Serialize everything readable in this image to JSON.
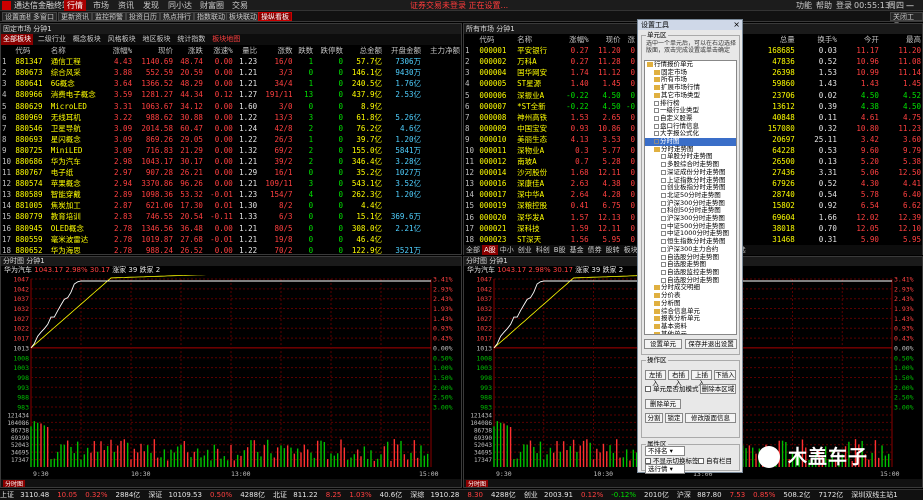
{
  "window": {
    "app_title": "通达信金融终端",
    "menus": [
      "行情",
      "市场",
      "资讯",
      "发现",
      "同小达",
      "财富圈",
      "交易"
    ],
    "active_menu": "行情",
    "notice": "证券交易未登录  正在设置...",
    "sys_items": [
      "功能",
      "帮助",
      "登录",
      "00:55:13",
      "周四"
    ]
  },
  "toolbar": {
    "buttons": [
      "设置面板",
      "多窗口",
      "更新资讯",
      "监控预警",
      "投资日历",
      "热点排行",
      "指数联动",
      "板块联动",
      "操纵看板"
    ],
    "active_button": "操纵看板",
    "right_text": "关闭工具"
  },
  "left_panel": {
    "title": "固定市场 分钟1",
    "tabs": [
      "全部板块",
      "二级行业",
      "概念板块",
      "风格板块",
      "地区板块",
      "统计指数",
      "板块地图"
    ],
    "active_tab": "全部板块",
    "columns": [
      "",
      "代码",
      "名称",
      "涨幅%",
      "现价",
      "涨跌",
      "涨速%",
      "量比",
      "涨数",
      "跌数",
      "跌停数",
      "总金额",
      "开盘金额",
      "主力净额"
    ],
    "rows": [
      [
        "1",
        "881347",
        "通信工程",
        "4.43",
        "1140.69",
        "48.74",
        "0.00",
        "1.23",
        "16/0",
        "1",
        "0",
        "57.7亿",
        "7306万",
        ""
      ],
      [
        "2",
        "880673",
        "综合风采",
        "3.88",
        "552.59",
        "20.59",
        "0.00",
        "1.21",
        "3/3",
        "0",
        "0",
        "146.1亿",
        "9430万",
        ""
      ],
      [
        "3",
        "880641",
        "6G概念",
        "3.64",
        "1366.52",
        "48.29",
        "0.00",
        "1.21",
        "34/4",
        "1",
        "0",
        "240.5亿",
        "1.76亿",
        ""
      ],
      [
        "4",
        "880966",
        "消费电子概念",
        "3.59",
        "1281.27",
        "44.34",
        "0.12",
        "1.27",
        "191/11",
        "13",
        "0",
        "437.9亿",
        "2.53亿",
        ""
      ],
      [
        "5",
        "880629",
        "MicroLED",
        "3.31",
        "1063.67",
        "34.12",
        "0.00",
        "1.60",
        "3/0",
        "0",
        "0",
        "8.9亿",
        "",
        ""
      ],
      [
        "6",
        "880969",
        "无线耳机",
        "3.22",
        "988.62",
        "30.88",
        "0.00",
        "1.22",
        "13/3",
        "3",
        "0",
        "61.8亿",
        "5.26亿",
        ""
      ],
      [
        "7",
        "880546",
        "卫星导航",
        "3.09",
        "2014.58",
        "60.47",
        "0.00",
        "1.24",
        "42/8",
        "2",
        "0",
        "76.2亿",
        "4.6亿",
        ""
      ],
      [
        "8",
        "880693",
        "星闪概念",
        "3.09",
        "869.26",
        "29.05",
        "0.00",
        "1.22",
        "26/3",
        "1",
        "0",
        "39.7亿",
        "1.20亿",
        ""
      ],
      [
        "9",
        "880725",
        "MiniLED",
        "3.09",
        "716.83",
        "21.29",
        "0.00",
        "1.32",
        "69/2",
        "2",
        "0",
        "155.0亿",
        "5841万",
        ""
      ],
      [
        "10",
        "880686",
        "华为汽车",
        "2.98",
        "1043.17",
        "30.17",
        "0.00",
        "1.21",
        "39/2",
        "2",
        "0",
        "346.4亿",
        "3.28亿",
        ""
      ],
      [
        "11",
        "880767",
        "电子纸",
        "2.97",
        "907.28",
        "26.21",
        "0.00",
        "1.29",
        "16/1",
        "0",
        "0",
        "35.2亿",
        "1027万",
        ""
      ],
      [
        "12",
        "880574",
        "苹果概念",
        "2.94",
        "3370.86",
        "96.26",
        "0.00",
        "1.21",
        "109/11",
        "3",
        "0",
        "543.1亿",
        "3.52亿",
        ""
      ],
      [
        "13",
        "880589",
        "智能穿戴",
        "2.89",
        "1098.36",
        "53.32",
        "-0.01",
        "1.23",
        "154/7",
        "4",
        "0",
        "262.3亿",
        "1.20亿",
        ""
      ],
      [
        "14",
        "881005",
        "焦炭加工",
        "2.87",
        "621.06",
        "17.30",
        "0.01",
        "1.30",
        "8/2",
        "0",
        "0",
        "4.4亿",
        "",
        ""
      ],
      [
        "15",
        "880779",
        "教育培训",
        "2.83",
        "746.55",
        "20.54",
        "-0.11",
        "1.33",
        "6/3",
        "0",
        "0",
        "15.1亿",
        "369.6万",
        ""
      ],
      [
        "16",
        "880945",
        "OLED概念",
        "2.78",
        "1346.56",
        "36.48",
        "0.00",
        "1.21",
        "80/5",
        "0",
        "0",
        "308.0亿",
        "2.21亿",
        ""
      ],
      [
        "17",
        "880559",
        "毫米波雷达",
        "2.78",
        "1019.87",
        "27.68",
        "-0.01",
        "1.21",
        "19/8",
        "0",
        "0",
        "46.4亿",
        "",
        ""
      ],
      [
        "18",
        "880652",
        "华为海思",
        "2.78",
        "988.24",
        "26.52",
        "0.00",
        "1.22",
        "70/2",
        "0",
        "0",
        "122.9亿",
        "3521万",
        ""
      ],
      [
        "19",
        "880511",
        "橡胶",
        "2.77",
        "681.06",
        "18.30",
        "0.00",
        "1.23",
        "11/1",
        "1",
        "0",
        "13.3亿",
        "384.5万",
        ""
      ]
    ]
  },
  "right_panel": {
    "title": "所有市场 分钟1",
    "tabs": [
      "全部",
      "A股",
      "中小",
      "创业",
      "科创",
      "B股",
      "基金",
      "债券",
      "股转",
      "板块",
      "港股",
      "期权",
      "美股",
      "期货",
      "外汇",
      "自选"
    ],
    "active_tab": "A股",
    "columns_left": [
      "",
      "代码",
      "名称",
      "涨幅%",
      "现价",
      "涨"
    ],
    "columns_right": [
      "总量",
      "换手%",
      "今开",
      "最高"
    ],
    "rows_left": [
      [
        "1",
        "000001",
        "平安银行",
        "0.27",
        "11.20",
        "0"
      ],
      [
        "2",
        "000002",
        "万科A",
        "0.27",
        "11.28",
        "0"
      ],
      [
        "3",
        "000004",
        "国华网安",
        "1.74",
        "11.12",
        "0"
      ],
      [
        "4",
        "000005",
        "ST星源",
        "1.40",
        "1.45",
        "0"
      ],
      [
        "5",
        "000006",
        "深振业A",
        "-0.22",
        "4.50",
        "0"
      ],
      [
        "6",
        "000007",
        "*ST全新",
        "-0.22",
        "4.50",
        "-0"
      ],
      [
        "7",
        "000008",
        "神州高铁",
        "1.53",
        "2.65",
        "0"
      ],
      [
        "8",
        "000009",
        "中国宝安",
        "0.93",
        "10.86",
        "0"
      ],
      [
        "9",
        "000010",
        "美丽生态",
        "4.13",
        "3.53",
        "0"
      ],
      [
        "10",
        "000011",
        "深物业A",
        "0.3",
        "5.77",
        "0"
      ],
      [
        "11",
        "000012",
        "南玻A",
        "0.7",
        "5.28",
        "0"
      ],
      [
        "12",
        "000014",
        "沙河股份",
        "1.68",
        "12.11",
        "0"
      ],
      [
        "13",
        "000016",
        "深康佳A",
        "2.63",
        "4.38",
        "0"
      ],
      [
        "14",
        "000017",
        "深中华A",
        "2.64",
        "4.28",
        "0"
      ],
      [
        "15",
        "000019",
        "深粮控股",
        "0.41",
        "6.75",
        "0"
      ],
      [
        "16",
        "000020",
        "深华发A",
        "1.57",
        "12.13",
        "0"
      ],
      [
        "17",
        "000021",
        "深科技",
        "1.59",
        "12.11",
        "0"
      ],
      [
        "18",
        "000023",
        "ST深天",
        "1.56",
        "5.95",
        "0"
      ],
      [
        "19",
        "000025",
        "特力A",
        "1.56",
        "12.65",
        "0"
      ]
    ],
    "rows_right": [
      [
        "168685",
        "0.03",
        "11.17",
        "11.20"
      ],
      [
        "47836",
        "0.52",
        "10.96",
        "11.08"
      ],
      [
        "26398",
        "1.53",
        "10.99",
        "11.14"
      ],
      [
        "59860",
        "1.43",
        "1.43",
        "1.45"
      ],
      [
        "23706",
        "0.02",
        "4.50",
        "4.52"
      ],
      [
        "13612",
        "0.39",
        "4.38",
        "4.50"
      ],
      [
        "40848",
        "0.11",
        "4.61",
        "4.75"
      ],
      [
        "157080",
        "0.32",
        "10.80",
        "11.23"
      ],
      [
        "20697",
        "25.11",
        "3.42",
        "3.60"
      ],
      [
        "64228",
        "0.53",
        "9.60",
        "9.79"
      ],
      [
        "26500",
        "0.13",
        "5.20",
        "5.38"
      ],
      [
        "27436",
        "3.31",
        "5.06",
        "12.50"
      ],
      [
        "67926",
        "0.52",
        "4.30",
        "4.41"
      ],
      [
        "28740",
        "0.54",
        "5.78",
        "6.40"
      ],
      [
        "15802",
        "0.92",
        "6.54",
        "6.62"
      ],
      [
        "69604",
        "1.66",
        "12.02",
        "12.39"
      ],
      [
        "38018",
        "0.70",
        "12.05",
        "12.10"
      ],
      [
        "31468",
        "0.31",
        "5.90",
        "5.95"
      ],
      [
        "4486",
        "0.04",
        "12.60",
        "12.68"
      ]
    ]
  },
  "chart_left": {
    "header": "分时图 分钟1",
    "legend_name": "华为汽车",
    "legend_value": "1043.17",
    "legend_pct": "2.98%",
    "legend_up": "30.17",
    "legend_rise": "涨家 39",
    "legend_fall": "跌家 2",
    "y_labels": [
      "1047",
      "1042",
      "1037",
      "1032",
      "1027",
      "1022",
      "1017",
      "1013",
      "1008",
      "1003",
      "998",
      "993",
      "988",
      "983"
    ],
    "y_labels_right": [
      "3.41%",
      "2.93%",
      "2.43%",
      "1.93%",
      "1.43%",
      "0.93%",
      "0.43%",
      "0.00%",
      "0.50%",
      "1.00%",
      "1.50%",
      "2.00%",
      "2.50%",
      "3.00%"
    ],
    "vol_labels": [
      "121434",
      "104086",
      "86738",
      "69390",
      "52043",
      "34695",
      "17347"
    ],
    "x_labels": [
      "9:30",
      "10:30",
      "13:00",
      "15:00"
    ]
  },
  "chart_right": {
    "header": "分时图 分钟1",
    "legend_name": "华为汽车",
    "legend_value": "1043.17",
    "legend_pct": "2.98%",
    "legend_up": "30.17",
    "legend_rise": "涨家 39",
    "legend_fall": "跌家 2",
    "y_labels": [
      "1047",
      "1042",
      "1037",
      "1032",
      "1027",
      "1022",
      "1017",
      "1013",
      "1008",
      "1003",
      "998",
      "993",
      "988",
      "983"
    ],
    "y_labels_right": [
      "3.41%",
      "2.93%",
      "2.43%",
      "1.93%",
      "1.43%",
      "0.93%",
      "0.43%",
      "0.00%",
      "0.50%",
      "1.00%",
      "1.50%",
      "2.00%",
      "2.50%",
      "3.00%"
    ],
    "vol_labels": [
      "121434",
      "104086",
      "86738",
      "69390",
      "52043",
      "34695",
      "17347"
    ],
    "x_labels": [
      "9:30",
      "10:30",
      "13:00",
      "15:00"
    ]
  },
  "dialog": {
    "title": "设置工具",
    "close": "×",
    "unit_group": "单元区",
    "unit_help": "选中一个单元后，可以在右边选择版面，双击完成设置或单击确定",
    "tree": [
      {
        "label": "行情报价单元",
        "level": 0,
        "folder": true
      },
      {
        "label": "固定市场",
        "level": 1,
        "folder": true
      },
      {
        "label": "所有市场",
        "level": 1,
        "folder": true
      },
      {
        "label": "扩展市场行情",
        "level": 1,
        "folder": true
      },
      {
        "label": "其它市场类型",
        "level": 1,
        "folder": true
      },
      {
        "label": "排行榜",
        "level": 1,
        "folder": false
      },
      {
        "label": "一级行业类型",
        "level": 1,
        "folder": false
      },
      {
        "label": "自定义股票",
        "level": 1,
        "folder": false
      },
      {
        "label": "盘口行情信息",
        "level": 1,
        "folder": false
      },
      {
        "label": "大字报公式化",
        "level": 1,
        "folder": false
      },
      {
        "label": "分时图",
        "level": 1,
        "folder": false,
        "selected": true
      },
      {
        "label": "分时走势图",
        "level": 1,
        "folder": true
      },
      {
        "label": "单股分时走势图",
        "level": 2,
        "folder": false
      },
      {
        "label": "多股综合时走势图",
        "level": 2,
        "folder": false
      },
      {
        "label": "深证成份分时走势图",
        "level": 2,
        "folder": false
      },
      {
        "label": "上证指数分时走势图",
        "level": 2,
        "folder": false
      },
      {
        "label": "创业板指分时走势图",
        "level": 2,
        "folder": false
      },
      {
        "label": "北证50分时走势图",
        "level": 2,
        "folder": false
      },
      {
        "label": "沪深300分时走势图",
        "level": 2,
        "folder": false
      },
      {
        "label": "科创50分时走势图",
        "level": 2,
        "folder": false
      },
      {
        "label": "沪深300分时走势图",
        "level": 2,
        "folder": false
      },
      {
        "label": "中证500分时走势图",
        "level": 2,
        "folder": false
      },
      {
        "label": "中证1000分时走势图",
        "level": 2,
        "folder": false
      },
      {
        "label": "恒生指数分时走势图",
        "level": 2,
        "folder": false
      },
      {
        "label": "沪深300主力合约",
        "level": 2,
        "folder": false
      },
      {
        "label": "自选股分时走势图",
        "level": 2,
        "folder": false
      },
      {
        "label": "自选股走势图",
        "level": 2,
        "folder": false
      },
      {
        "label": "自选股监控走势图",
        "level": 2,
        "folder": false
      },
      {
        "label": "自选股分时走势图",
        "level": 2,
        "folder": false
      },
      {
        "label": "分时成交明细",
        "level": 1,
        "folder": true
      },
      {
        "label": "分价表",
        "level": 1,
        "folder": true
      },
      {
        "label": "分析图",
        "level": 1,
        "folder": true
      },
      {
        "label": "综合信息单元",
        "level": 1,
        "folder": true
      },
      {
        "label": "报表分析单元",
        "level": 1,
        "folder": true
      },
      {
        "label": "基本资料",
        "level": 1,
        "folder": true
      },
      {
        "label": "其他单元",
        "level": 1,
        "folder": true
      }
    ],
    "btn_set_unit": "设置单元",
    "btn_save_exit": "保存并退出设置",
    "op_group": "操作区",
    "btn_left": "左插入",
    "btn_right": "右插入",
    "btn_up": "上插入",
    "btn_down": "下插入",
    "chk_unit_mode": "单元是否加模式",
    "btn_delete_unit": "删除单元",
    "btn_delete_region": "删除本区域",
    "btn_split": "分割",
    "btn_lock": "锁定",
    "btn_modify": "修改版面信息",
    "attr_group": "属性区",
    "attr_select": "不排名",
    "chk_no_switch": "不显示切换标签",
    "chk_auto_color": "自有栏目",
    "select_row": "选行情"
  },
  "status": {
    "items": [
      {
        "label": "上证",
        "value": "3110.48",
        "cls": "wh"
      },
      {
        "label": "",
        "value": "10.05",
        "cls": "up"
      },
      {
        "label": "",
        "value": "0.32%",
        "cls": "up"
      },
      {
        "label": "",
        "value": "2884亿",
        "cls": "wh"
      },
      {
        "label": "深证",
        "value": "10109.53",
        "cls": "wh"
      },
      {
        "label": "",
        "value": "0.50%",
        "cls": "up"
      },
      {
        "label": "",
        "value": "4288亿",
        "cls": "wh"
      },
      {
        "label": "北证",
        "value": "811.22",
        "cls": "wh"
      },
      {
        "label": "",
        "value": "8.25",
        "cls": "up"
      },
      {
        "label": "",
        "value": "1.03%",
        "cls": "up"
      },
      {
        "label": "",
        "value": "40.6亿",
        "cls": "wh"
      },
      {
        "label": "深综",
        "value": "1910.28",
        "cls": "wh"
      },
      {
        "label": "",
        "value": "8.30",
        "cls": "up"
      },
      {
        "label": "",
        "value": "4288亿",
        "cls": "wh"
      },
      {
        "label": "创业",
        "value": "2003.91",
        "cls": "wh"
      },
      {
        "label": "",
        "value": "0.12%",
        "cls": "up"
      },
      {
        "label": "",
        "value": "-0.12%",
        "cls": "dn"
      },
      {
        "label": "",
        "value": "2010亿",
        "cls": "wh"
      },
      {
        "label": "沪深",
        "value": "887.80",
        "cls": "wh"
      },
      {
        "label": "",
        "value": "7.53",
        "cls": "up"
      },
      {
        "label": "",
        "value": "0.85%",
        "cls": "up"
      },
      {
        "label": "",
        "value": "508.2亿",
        "cls": "wh"
      },
      {
        "label": "",
        "value": "7172亿",
        "cls": "wh"
      },
      {
        "label": "",
        "value": "深圳双线主站1",
        "cls": "wh"
      }
    ]
  },
  "watermark": {
    "text": "木盖车子"
  },
  "colors": {
    "up": "#ff4040",
    "down": "#00e000",
    "code": "#ffff00",
    "active_tab": "#8a0000"
  }
}
